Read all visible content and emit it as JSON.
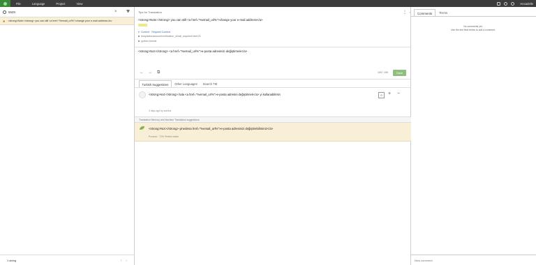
{
  "menu": {
    "items": [
      "File",
      "Language",
      "Project",
      "View"
    ]
  },
  "user": {
    "name": "Hexadelle"
  },
  "search": {
    "value": "5529"
  },
  "string_list": {
    "row_text": "<strong>Note:</strong> you can still <a href=\"%email_url%\">change your e-mail address</a>"
  },
  "footer": {
    "count": "1 string"
  },
  "editor": {
    "tips": "Tips for Translation",
    "source": "<strong>Note:</strong> you can still <a href=\"%email_url%\">change your e-mail address</a>",
    "context_label": "Context",
    "context_request": "Request Context",
    "context_key": "templates/account/verification_email_required.html:21",
    "context_format": "python-format",
    "target": "<strong>Not:</strong> <a href=\"%email_url%\">e-posta adresinizi değiştirmek</a>",
    "count": "106 / 106",
    "save": "Save"
  },
  "suggestion_tabs": [
    "Turkish Suggestions",
    "Other Languages",
    "Search TM"
  ],
  "suggestion": {
    "text": "<strong>Not:</strong> hala <a href=\"%email_url%\">e-posta adresini değiştirmek</a> yi kullanabilirsin",
    "score": "0",
    "meta": "3 days ago by sadrtuz"
  },
  "tm": {
    "header": "Translation Memory and Machine Translation suggestions",
    "text": "<strong>Not:</strong> yinedena href=\"%email_url%\">e-posta adresinizi değiştirebilirsiniz</a>",
    "meta": "Pontoon · 72% Perfect match"
  },
  "right_tabs": [
    "Comments",
    "Terms"
  ],
  "comments": {
    "empty_title": "No comments yet.",
    "empty_hint": "Use the text field below to add a comment.",
    "new_placeholder": "New comment"
  }
}
